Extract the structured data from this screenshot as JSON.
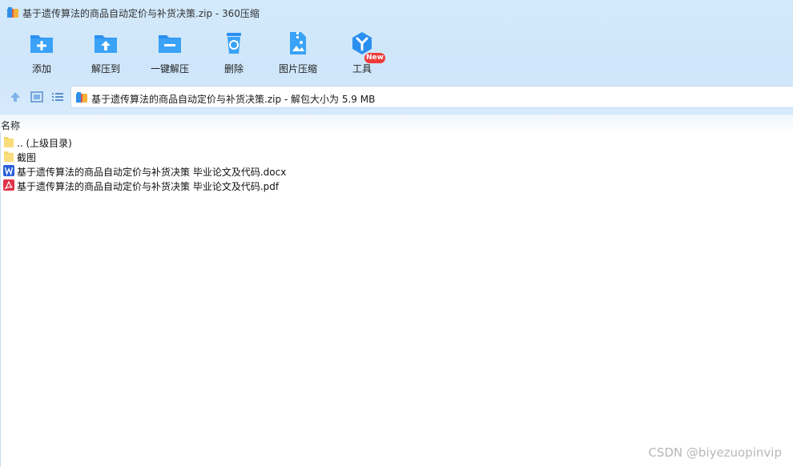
{
  "window": {
    "title": "基于遗传算法的商品自动定价与补货决策.zip - 360压缩"
  },
  "toolbar": {
    "items": [
      {
        "label": "添加",
        "icon": "add-folder-icon"
      },
      {
        "label": "解压到",
        "icon": "extract-to-icon"
      },
      {
        "label": "一键解压",
        "icon": "one-click-extract-icon"
      },
      {
        "label": "删除",
        "icon": "recycle-bin-icon"
      },
      {
        "label": "图片压缩",
        "icon": "image-compress-icon"
      },
      {
        "label": "工具",
        "icon": "tools-icon"
      }
    ],
    "new_badge": "New"
  },
  "address": {
    "text": "基于遗传算法的商品自动定价与补货决策.zip - 解包大小为 5.9 MB"
  },
  "list": {
    "column_name": "名称",
    "files": [
      {
        "name": ".. (上级目录)",
        "type": "folder"
      },
      {
        "name": "截图",
        "type": "folder"
      },
      {
        "name": "基于遗传算法的商品自动定价与补货决策 毕业论文及代码.docx",
        "type": "word"
      },
      {
        "name": "基于遗传算法的商品自动定价与补货决策 毕业论文及代码.pdf",
        "type": "pdf"
      }
    ]
  },
  "watermark": "CSDN @biyezuopinvip",
  "colors": {
    "accent": "#1f8ff0",
    "folder": "#f6d56b",
    "word": "#2b5fd9",
    "pdf": "#e0344a",
    "badge": "#f03a3a"
  }
}
